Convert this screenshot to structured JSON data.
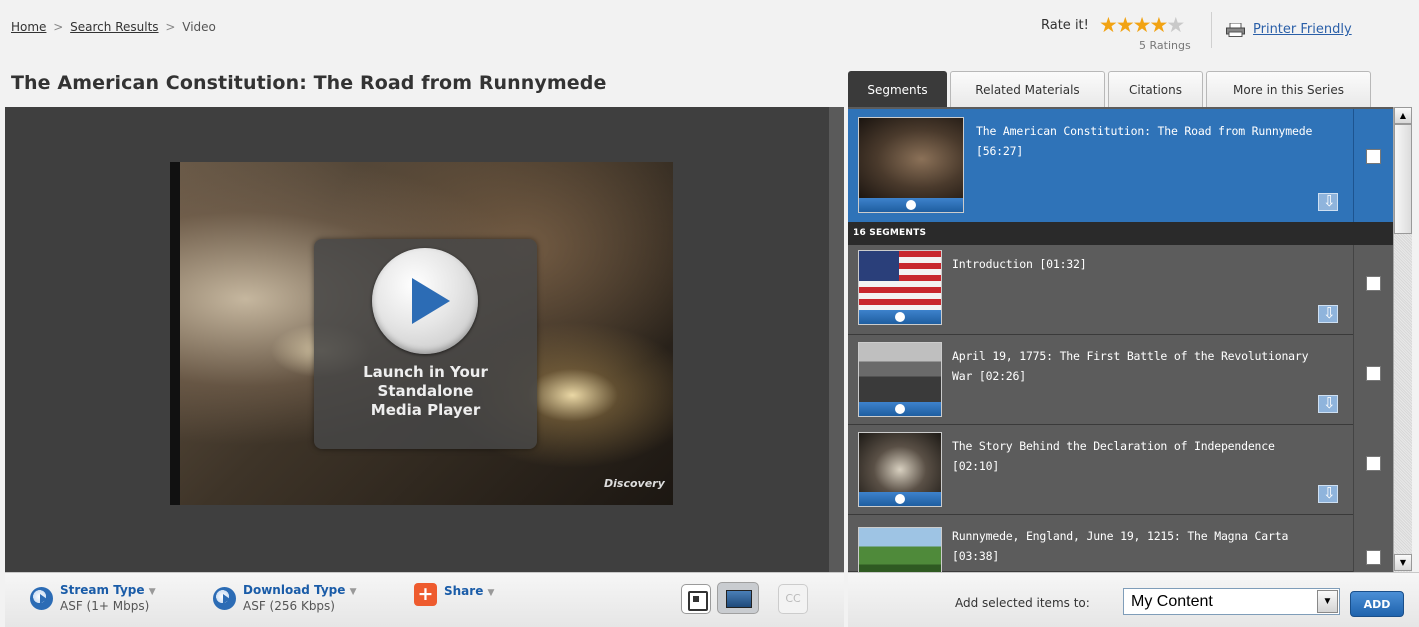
{
  "breadcrumb": {
    "home": "Home",
    "search_results": "Search Results",
    "current": "Video",
    "separator": ">"
  },
  "page_title": "The American Constitution: The Road from Runnymede",
  "rating": {
    "label": "Rate it!",
    "stars_filled": 4,
    "stars_total": 5,
    "count_text": "5 Ratings"
  },
  "printer_friendly": "Printer Friendly",
  "tabs": [
    {
      "label": "Segments",
      "active": true
    },
    {
      "label": "Related Materials",
      "active": false
    },
    {
      "label": "Citations",
      "active": false
    },
    {
      "label": "More in this Series",
      "active": false
    }
  ],
  "player": {
    "launch_line1": "Launch in Your",
    "launch_line2": "Standalone",
    "launch_line3": "Media Player",
    "watermark": "Discovery"
  },
  "toolbar": {
    "stream_title": "Stream Type",
    "stream_value": "ASF (1+ Mbps)",
    "download_title": "Download Type",
    "download_value": "ASF (256 Kbps)",
    "share_title": "Share",
    "share_glyph": "+",
    "cc_label": "CC",
    "dropdown_glyph": "▼"
  },
  "featured": {
    "title": "The American Constitution: The Road from Runnymede",
    "duration": "[56:27]"
  },
  "segments_header": "16 SEGMENTS",
  "segments": [
    {
      "title": "Introduction [01:32]",
      "line2": ""
    },
    {
      "title": "April 19, 1775: The First Battle of the Revolutionary",
      "line2": "War [02:26]"
    },
    {
      "title": "The Story Behind the Declaration of Independence",
      "line2": "[02:10]"
    },
    {
      "title": "Runnymede, England, June 19, 1215: The Magna Carta",
      "line2": "[03:38]"
    }
  ],
  "add_to": {
    "label": "Add selected items to:",
    "selected": "My Content",
    "button": "ADD"
  },
  "colors": {
    "accent_blue": "#2f73b8",
    "star": "#f2a313",
    "share_orange": "#ee5b2e"
  }
}
